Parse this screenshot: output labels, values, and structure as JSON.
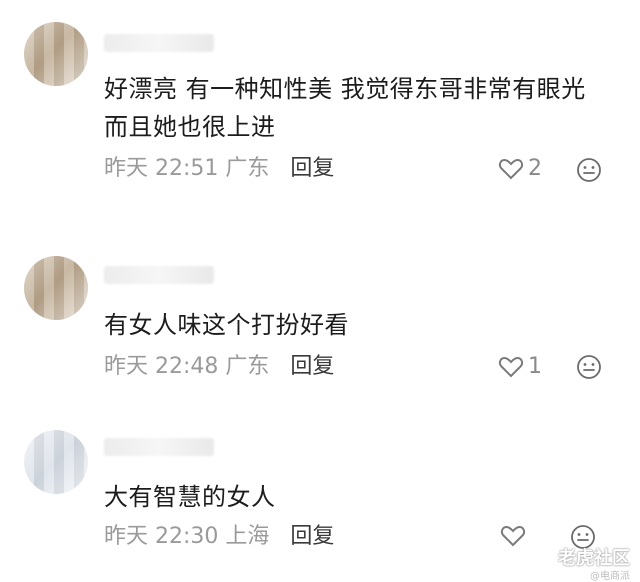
{
  "comments": [
    {
      "text": "好漂亮 有一种知性美 我觉得东哥非常有眼光 而且她也很上进",
      "time": "昨天 22:51",
      "location": "广东",
      "reply_label": "回复",
      "likes": "2"
    },
    {
      "text": "有女人味这个打扮好看",
      "time": "昨天 22:48",
      "location": "广东",
      "reply_label": "回复",
      "likes": "1"
    },
    {
      "text": "大有智慧的女人",
      "time": "昨天 22:30",
      "location": "上海",
      "reply_label": "回复",
      "likes": ""
    }
  ],
  "watermark": {
    "main": "老虎社区",
    "sub": "@电商派"
  },
  "icons": {
    "like": "heart-outline-icon",
    "emoji": "smiley-icon"
  },
  "colors": {
    "meta": "#9a9a9a",
    "text": "#1c1c1c"
  }
}
